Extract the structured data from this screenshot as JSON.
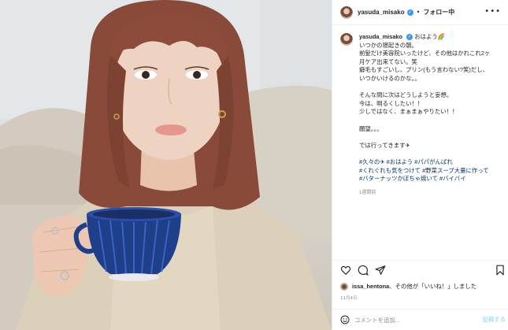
{
  "photo": {
    "description_icon": "selfie-photo"
  },
  "header": {
    "username": "yasuda_misako",
    "separator": "•",
    "follow_label": "フォロー中",
    "more_icon": "ellipsis-icon"
  },
  "caption": {
    "username": "yasuda_misako",
    "lines": [
      "おはよう🌈",
      "いつかの寝起きの朝。",
      "前髪だけ美容院いったけど、その他はかれこれ2ヶ",
      "月ケア出来てない。笑",
      "癖毛もすごいし、プリン(もう言わない?笑)だし、",
      "いつかいけるのかな。。",
      "",
      "そんな間に次はどうしようと妄想。",
      "今は、明るくしたい！！",
      "少しではなく、まぁまぁやりたい！！",
      "",
      "願望。。。",
      "",
      "では行ってきます✈",
      ""
    ],
    "hashtag_lines": [
      "#久々の✈ #おはよう #パパがんばれ",
      "#くれぐれも気をつけて #野菜スープ大量に作って",
      "#バターナッツかぼちゃ焼いて #バイバイ"
    ],
    "time": "1週間前"
  },
  "likes": {
    "user": "issa_hentona",
    "text": "、その他が「いいね！」しました"
  },
  "date": "11月4日",
  "comment": {
    "placeholder": "コメントを追加...",
    "post_label": "投稿する"
  },
  "colors": {
    "link": "#00376b",
    "verified": "#3897f0",
    "post_disabled": "#b2dffc",
    "muted": "#8e8e8e"
  }
}
